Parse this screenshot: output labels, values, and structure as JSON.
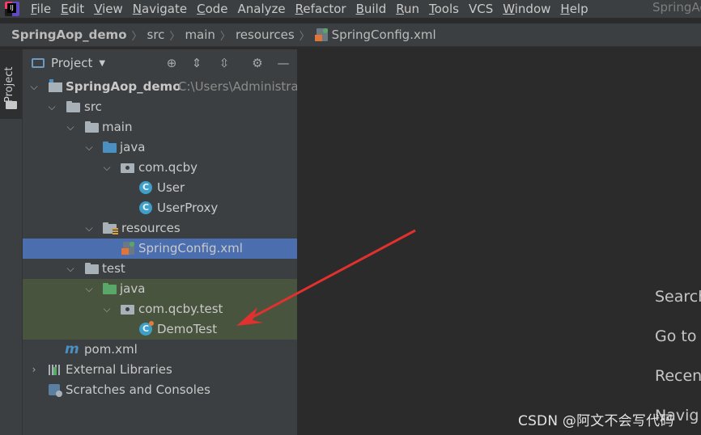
{
  "menubar": {
    "logo_text": "IJ",
    "items": [
      "File",
      "Edit",
      "View",
      "Navigate",
      "Code",
      "Analyze",
      "Refactor",
      "Build",
      "Run",
      "Tools",
      "VCS",
      "Window",
      "Help"
    ],
    "window_title": "SpringAo"
  },
  "breadcrumb": [
    "SpringAop_demo",
    "src",
    "main",
    "resources",
    "SpringConfig.xml"
  ],
  "tool_strip": {
    "project_tab": "Project"
  },
  "project_panel": {
    "title": "Project",
    "tree": {
      "root_name": "SpringAop_demo",
      "root_path": "C:\\Users\\Administrat",
      "src": "src",
      "main": "main",
      "main_java": "java",
      "main_package": "com.qcby",
      "class_user": "User",
      "class_userproxy": "UserProxy",
      "resources": "resources",
      "spring_config": "SpringConfig.xml",
      "test": "test",
      "test_java": "java",
      "test_package": "com.qcby.test",
      "class_demotest": "DemoTest",
      "pom": "pom.xml",
      "external_libraries": "External Libraries",
      "scratches": "Scratches and Consoles"
    }
  },
  "editor_hints": [
    "Search",
    "Go to",
    "Recen",
    "Navig"
  ],
  "watermark": "CSDN @阿文不会写代码"
}
